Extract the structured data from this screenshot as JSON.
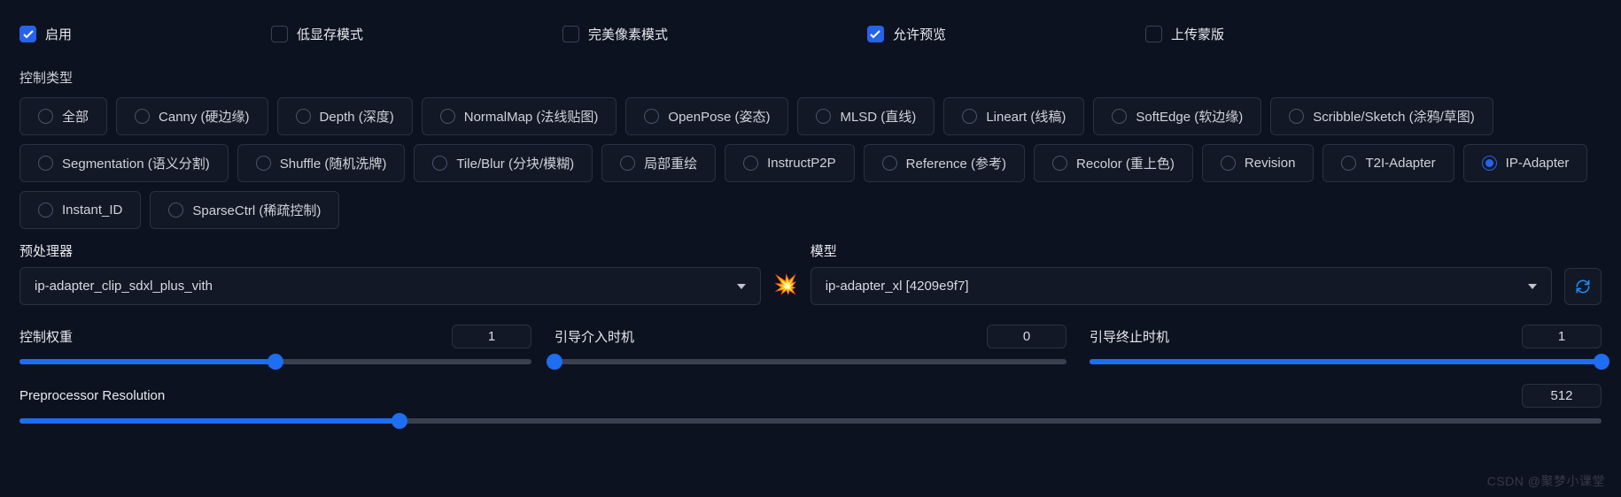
{
  "checkboxes": {
    "enable": {
      "label": "启用",
      "checked": true
    },
    "lowvram": {
      "label": "低显存模式",
      "checked": false
    },
    "pixelperfect": {
      "label": "完美像素模式",
      "checked": false
    },
    "allowpreview": {
      "label": "允许预览",
      "checked": true
    },
    "uploadmask": {
      "label": "上传蒙版",
      "checked": false
    }
  },
  "control_type_label": "控制类型",
  "control_types": [
    {
      "key": "all",
      "label": "全部",
      "selected": false
    },
    {
      "key": "canny",
      "label": "Canny (硬边缘)",
      "selected": false
    },
    {
      "key": "depth",
      "label": "Depth (深度)",
      "selected": false
    },
    {
      "key": "normalmap",
      "label": "NormalMap (法线贴图)",
      "selected": false
    },
    {
      "key": "openpose",
      "label": "OpenPose (姿态)",
      "selected": false
    },
    {
      "key": "mlsd",
      "label": "MLSD (直线)",
      "selected": false
    },
    {
      "key": "lineart",
      "label": "Lineart (线稿)",
      "selected": false
    },
    {
      "key": "softedge",
      "label": "SoftEdge (软边缘)",
      "selected": false
    },
    {
      "key": "scribble",
      "label": "Scribble/Sketch (涂鸦/草图)",
      "selected": false
    },
    {
      "key": "segmentation",
      "label": "Segmentation (语义分割)",
      "selected": false
    },
    {
      "key": "shuffle",
      "label": "Shuffle (随机洗牌)",
      "selected": false
    },
    {
      "key": "tile",
      "label": "Tile/Blur (分块/模糊)",
      "selected": false
    },
    {
      "key": "inpaint",
      "label": "局部重绘",
      "selected": false
    },
    {
      "key": "instructp2p",
      "label": "InstructP2P",
      "selected": false
    },
    {
      "key": "reference",
      "label": "Reference (参考)",
      "selected": false
    },
    {
      "key": "recolor",
      "label": "Recolor (重上色)",
      "selected": false
    },
    {
      "key": "revision",
      "label": "Revision",
      "selected": false
    },
    {
      "key": "t2i",
      "label": "T2I-Adapter",
      "selected": false
    },
    {
      "key": "ip",
      "label": "IP-Adapter",
      "selected": true
    },
    {
      "key": "instantid",
      "label": "Instant_ID",
      "selected": false
    },
    {
      "key": "sparsectrl",
      "label": "SparseCtrl (稀疏控制)",
      "selected": false
    }
  ],
  "preprocessor": {
    "label": "预处理器",
    "value": "ip-adapter_clip_sdxl_plus_vith"
  },
  "model": {
    "label": "模型",
    "value": "ip-adapter_xl [4209e9f7]"
  },
  "explode_icon": "💥",
  "sliders": {
    "weight": {
      "label": "控制权重",
      "value": "1",
      "fill_pct": 50
    },
    "start": {
      "label": "引导介入时机",
      "value": "0",
      "fill_pct": 0
    },
    "end": {
      "label": "引导终止时机",
      "value": "1",
      "fill_pct": 100
    },
    "res": {
      "label": "Preprocessor Resolution",
      "value": "512",
      "fill_pct": 24
    }
  },
  "watermark": "CSDN @聚梦小课堂"
}
